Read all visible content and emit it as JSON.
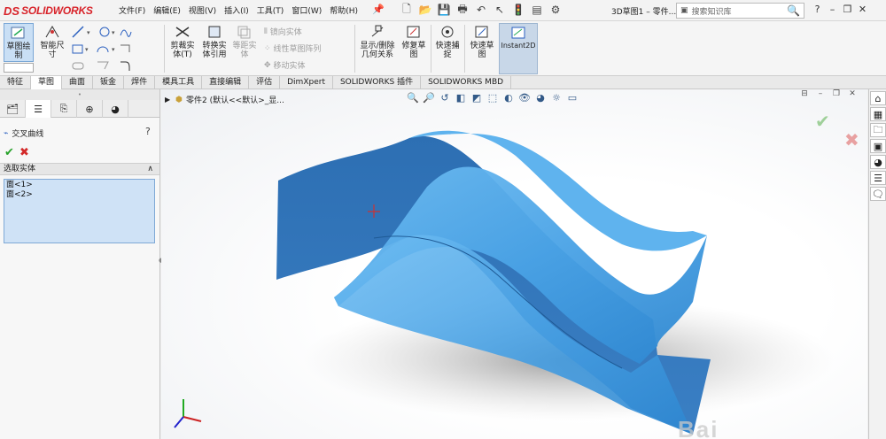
{
  "app": {
    "logo_mark": "DS",
    "logo_text": "SOLIDWORKS",
    "window_title": "3D草图1 – 零件...",
    "search_placeholder": "搜索知识库",
    "menu": [
      "文件(F)",
      "编辑(E)",
      "视图(V)",
      "插入(I)",
      "工具(T)",
      "窗口(W)",
      "帮助(H)"
    ]
  },
  "commands": {
    "sketch": "草图绘\n制",
    "smart_dim": "智能尺\n寸",
    "trim": "剪裁实\n体(T)",
    "convert": "转换实\n体引用",
    "offset": "等距实\n体",
    "mirror": "镜向实体",
    "linear_pattern": "线性草图阵列",
    "move": "移动实体",
    "show_relations": "显示/删除\n几何关系",
    "repair": "修复草\n图",
    "quick_snap": "快速捕\n捉",
    "rapid_sketch": "快速草\n图",
    "instant2d": "Instant2D"
  },
  "tabs": [
    "特征",
    "草图",
    "曲面",
    "钣金",
    "焊件",
    "模具工具",
    "直接编辑",
    "评估",
    "DimXpert",
    "SOLIDWORKS 插件",
    "SOLIDWORKS MBD"
  ],
  "active_tab": "草图",
  "property_manager": {
    "title": "交叉曲线",
    "help": "?",
    "section_title": "选取实体",
    "selections": [
      "面<1>",
      "面<2>"
    ]
  },
  "viewport": {
    "tree_label": "零件2 (默认<<默认>_显..."
  },
  "watermark": "Bai"
}
